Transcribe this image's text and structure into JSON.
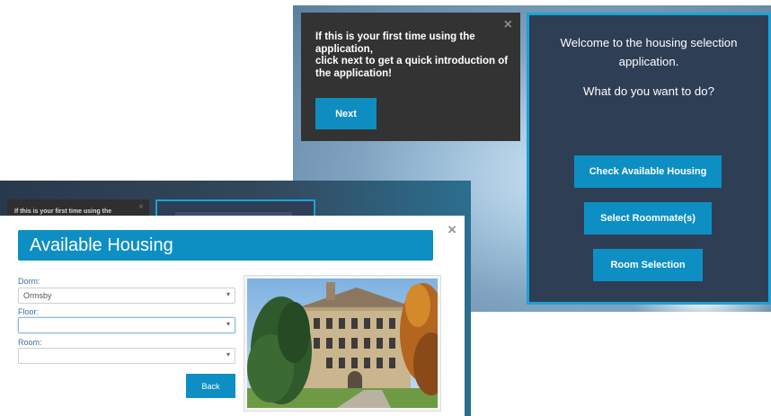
{
  "welcome_screen": {
    "tooltip": {
      "message_lines": [
        "If this is your first time using the",
        "application,",
        "click next to get a quick introduction of",
        "the application!"
      ],
      "close_glyph": "×",
      "next_label": "Next"
    },
    "panel": {
      "title_line1": "Welcome to the housing selection",
      "title_line2": "application.",
      "question": "What do you want to do?",
      "actions": [
        "Check Available Housing",
        "Select Roommate(s)",
        "Room Selection"
      ]
    }
  },
  "housing_screen": {
    "background_tooltip_text": "If this is your first time using the",
    "modal": {
      "title": "Available Housing",
      "close_glyph": "×",
      "fields": {
        "dorm": {
          "label": "Dorm:",
          "value": "Ormsby"
        },
        "floor": {
          "label": "Floor:",
          "value": ""
        },
        "room": {
          "label": "Room:",
          "value": ""
        }
      },
      "dropdown_caret": "▾",
      "back_label": "Back"
    }
  },
  "colors": {
    "accent_blue": "#0d8fc4",
    "panel_navy": "#2e3e55",
    "panel_border": "#19a3d6",
    "tooltip_dark": "#333333"
  },
  "icons": {
    "close": "close-icon",
    "dropdown": "chevron-down-icon"
  }
}
